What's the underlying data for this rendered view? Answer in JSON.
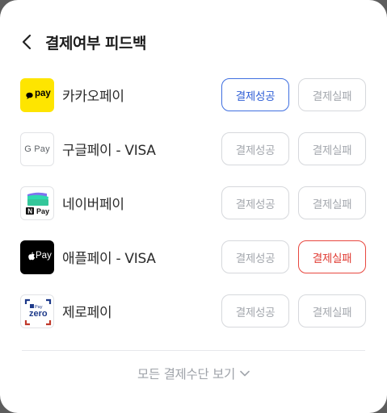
{
  "header": {
    "title": "결제여부 피드백"
  },
  "rows": [
    {
      "name": "카카오페이",
      "success_label": "결제성공",
      "fail_label": "결제실패",
      "logo_text": "pay",
      "selected": "success"
    },
    {
      "name": "구글페이 - VISA",
      "success_label": "결제성공",
      "fail_label": "결제실패",
      "logo_text": "G Pay",
      "selected": ""
    },
    {
      "name": "네이버페이",
      "success_label": "결제성공",
      "fail_label": "결제실패",
      "logo_text": "Pay",
      "selected": ""
    },
    {
      "name": "애플페이 - VISA",
      "success_label": "결제성공",
      "fail_label": "결제실패",
      "logo_text": "Pay",
      "selected": "fail"
    },
    {
      "name": "제로페이",
      "success_label": "결제성공",
      "fail_label": "결제실패",
      "logo_text": "zero",
      "selected": ""
    }
  ],
  "footer": {
    "more_label": "모든 결제수단 보기"
  },
  "colors": {
    "kakao": "#FEE500",
    "selected_blue": "#3F6FE0",
    "selected_red": "#E8473F"
  }
}
